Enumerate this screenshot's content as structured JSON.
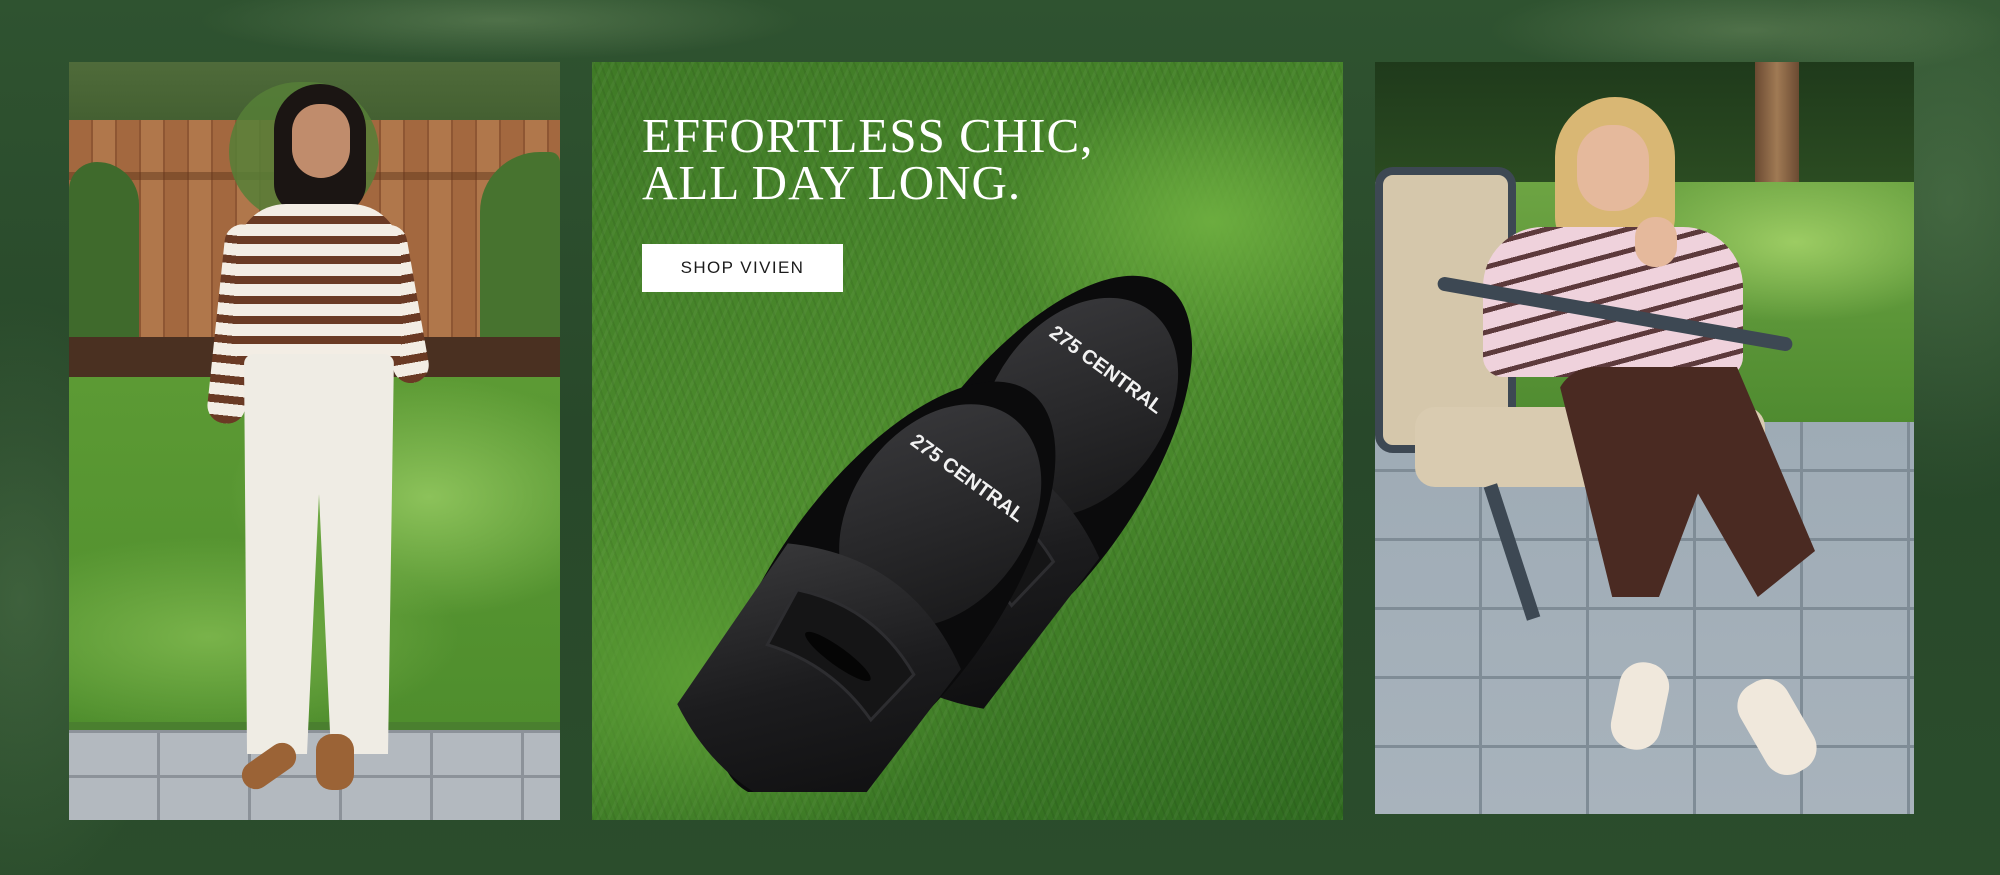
{
  "hero": {
    "headline_line1": "EFFORTLESS CHIC,",
    "headline_line2": "ALL DAY LONG.",
    "cta_label": "SHOP VIVIEN"
  },
  "product": {
    "insole_brand": "275 CENTRAL"
  },
  "colors": {
    "frame_green": "#2b4d2c",
    "button_bg": "#ffffff",
    "headline_text": "#ffffff"
  }
}
